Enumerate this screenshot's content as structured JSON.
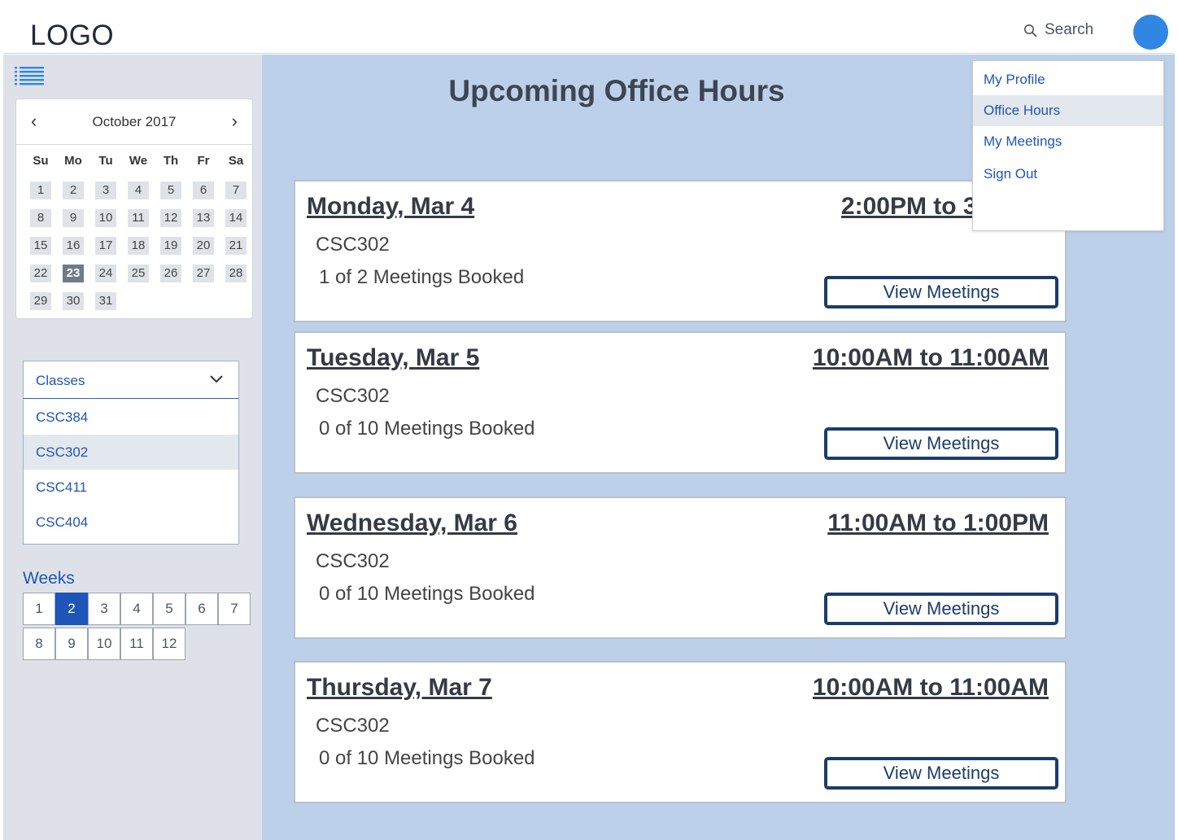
{
  "header": {
    "logo": "LOGO",
    "search_label": "Search"
  },
  "sidebar": {
    "menu_icon": "list-icon",
    "calendar": {
      "month_label": "October 2017",
      "weekdays": [
        "Su",
        "Mo",
        "Tu",
        "We",
        "Th",
        "Fr",
        "Sa"
      ],
      "days": [
        "1",
        "2",
        "3",
        "4",
        "5",
        "6",
        "7",
        "8",
        "9",
        "10",
        "11",
        "12",
        "13",
        "14",
        "15",
        "16",
        "17",
        "18",
        "19",
        "20",
        "21",
        "22",
        "23",
        "24",
        "25",
        "26",
        "27",
        "28",
        "29",
        "30",
        "31"
      ],
      "selected_day": "23",
      "first_weekday_index": 0
    },
    "classes": {
      "label": "Classes",
      "items": [
        "CSC384",
        "CSC302",
        "CSC411",
        "CSC404"
      ],
      "active": "CSC302"
    },
    "weeks": {
      "label": "Weeks",
      "items": [
        "1",
        "2",
        "3",
        "4",
        "5",
        "6",
        "7",
        "8",
        "9",
        "10",
        "11",
        "12"
      ],
      "active": "2"
    }
  },
  "main": {
    "title": "Upcoming Office Hours",
    "cards": [
      {
        "day": "Monday, Mar 4",
        "time": "2:00PM to 3:00PM",
        "course": "CSC302",
        "booked": "1 of 2 Meetings Booked",
        "button": "View Meetings"
      },
      {
        "day": "Tuesday, Mar 5",
        "time": "10:00AM to 11:00AM",
        "course": "CSC302",
        "booked": "0 of 10 Meetings Booked",
        "button": "View Meetings"
      },
      {
        "day": "Wednesday, Mar 6",
        "time": "11:00AM to 1:00PM",
        "course": "CSC302",
        "booked": "0 of 10 Meetings Booked",
        "button": "View Meetings"
      },
      {
        "day": "Thursday, Mar 7",
        "time": "10:00AM to 11:00AM",
        "course": "CSC302",
        "booked": "0 of 10 Meetings Booked",
        "button": "View Meetings"
      }
    ]
  },
  "user_menu": {
    "items": [
      "My Profile",
      "Office Hours",
      "My Meetings",
      "Sign Out"
    ],
    "active": "Office Hours"
  },
  "colors": {
    "accent": "#1f55b8",
    "avatar": "#2f86e3",
    "main_bg": "#bdd0ea",
    "sidebar_bg": "#dee2e8",
    "button_border": "#1b3c6b"
  }
}
